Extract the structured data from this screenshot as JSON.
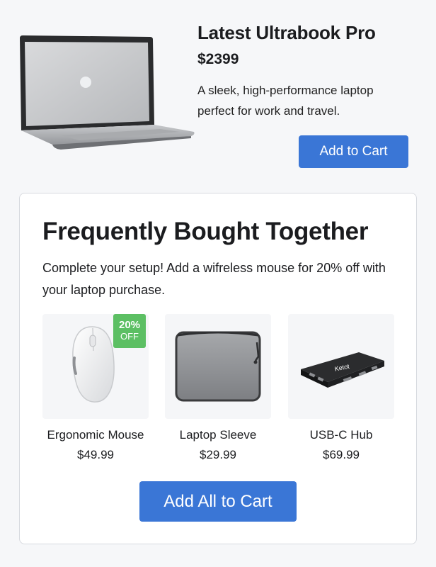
{
  "hero": {
    "image_icon": "laptop-icon",
    "title": "Latest Ultrabook Pro",
    "price": "$2399",
    "description": "A sleek, high-performance laptop perfect for work and travel.",
    "add_to_cart_label": "Add to Cart"
  },
  "bundle": {
    "title": "Frequently Bought Together",
    "description": "Complete your setup! Add a wifreless mouse for 20% off with your laptop purchase.",
    "items": [
      {
        "name": "Ergonomic Mouse",
        "price": "$49.99",
        "icon": "mouse-icon",
        "badge": {
          "percent": "20%",
          "off": "OFF"
        }
      },
      {
        "name": "Laptop Sleeve",
        "price": "$29.99",
        "icon": "laptop-sleeve-icon"
      },
      {
        "name": "USB-C Hub",
        "price": "$69.99",
        "icon": "usb-hub-icon",
        "brand_text": "Ketot"
      }
    ],
    "add_all_label": "Add All to Cart"
  },
  "colors": {
    "accent": "#3a76d6",
    "badge": "#5cbf63",
    "background": "#f6f7f9",
    "card": "#ffffff"
  }
}
